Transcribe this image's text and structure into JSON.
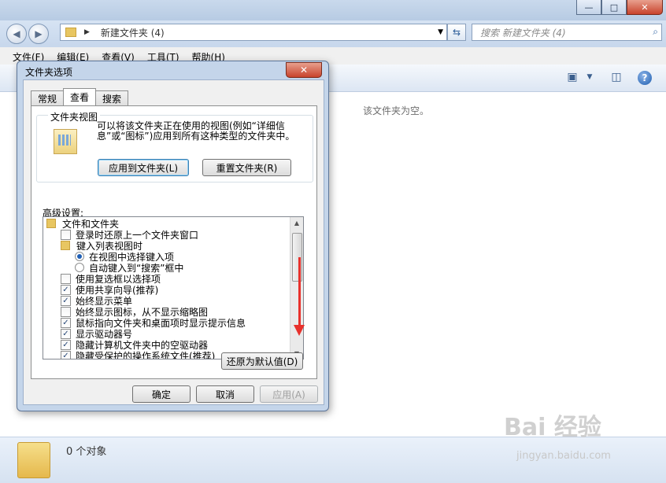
{
  "explorer": {
    "address_crumb": "新建文件夹 (4)",
    "search_placeholder": "搜索 新建文件夹 (4)",
    "menu": [
      "文件(F)",
      "编辑(E)",
      "查看(V)",
      "工具(T)",
      "帮助(H)"
    ],
    "empty_text": "该文件夹为空。",
    "status_count": "0 个对象"
  },
  "dialog": {
    "title": "文件夹选项",
    "close_symbol": "✕",
    "tabs": [
      "常规",
      "查看",
      "搜索"
    ],
    "active_tab": "查看",
    "folder_view": {
      "label": "文件夹视图",
      "description": "可以将该文件夹正在使用的视图(例如“详细信息”或“图标”)应用到所有这种类型的文件夹中。",
      "apply_button": "应用到文件夹(L)",
      "reset_button": "重置文件夹(R)"
    },
    "advanced_label": "高级设置:",
    "tree": [
      {
        "type": "folder",
        "indent": 0,
        "text": "文件和文件夹"
      },
      {
        "type": "checkbox",
        "indent": 1,
        "checked": false,
        "text": "登录时还原上一个文件夹窗口"
      },
      {
        "type": "folder",
        "indent": 1,
        "text": "键入列表视图时"
      },
      {
        "type": "radio",
        "indent": 2,
        "checked": true,
        "text": "在视图中选择键入项"
      },
      {
        "type": "radio",
        "indent": 2,
        "checked": false,
        "text": "自动键入到“搜索”框中"
      },
      {
        "type": "checkbox",
        "indent": 1,
        "checked": false,
        "text": "使用复选框以选择项"
      },
      {
        "type": "checkbox",
        "indent": 1,
        "checked": true,
        "text": "使用共享向导(推荐)"
      },
      {
        "type": "checkbox",
        "indent": 1,
        "checked": true,
        "text": "始终显示菜单"
      },
      {
        "type": "checkbox",
        "indent": 1,
        "checked": false,
        "text": "始终显示图标，从不显示缩略图"
      },
      {
        "type": "checkbox",
        "indent": 1,
        "checked": true,
        "text": "鼠标指向文件夹和桌面项时显示提示信息"
      },
      {
        "type": "checkbox",
        "indent": 1,
        "checked": true,
        "text": "显示驱动器号"
      },
      {
        "type": "checkbox",
        "indent": 1,
        "checked": true,
        "text": "隐藏计算机文件夹中的空驱动器"
      },
      {
        "type": "checkbox",
        "indent": 1,
        "checked": true,
        "text": "隐藏受保护的操作系统文件(推荐)"
      }
    ],
    "restore_defaults_button": "还原为默认值(D)",
    "ok_button": "确定",
    "cancel_button": "取消",
    "apply_button": "应用(A)"
  },
  "watermark": {
    "brand": "Bai 经验",
    "url": "jingyan.baidu.com"
  },
  "colors": {
    "annotation_arrow": "#e8312c",
    "close_button": "#c8432c"
  }
}
